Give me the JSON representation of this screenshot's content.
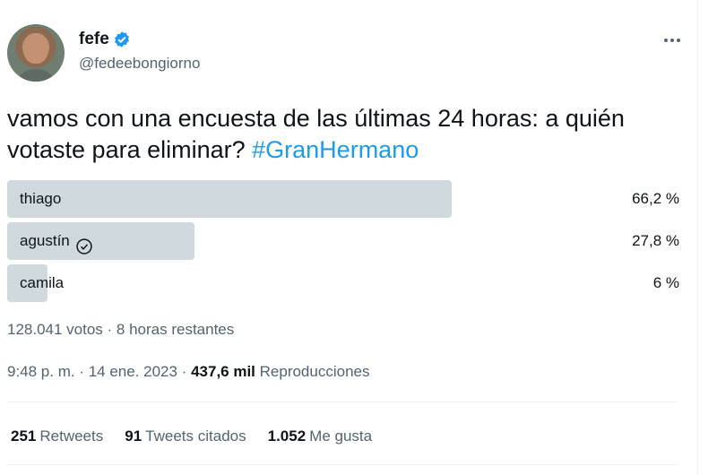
{
  "author": {
    "display_name": "fefe",
    "handle": "@fedeebongiorno"
  },
  "icons": {
    "verified": "verified-badge-icon",
    "more": "more-options-icon",
    "voted": "check-circle-icon"
  },
  "colors": {
    "accent": "#1d9bf0",
    "poll_bar": "#cfd9de",
    "secondary_text": "#536471"
  },
  "tweet": {
    "text": "vamos con una encuesta de las últimas 24 horas: a quién votaste para eliminar? ",
    "hashtag": "#GranHermano"
  },
  "poll": {
    "options": [
      {
        "label": "thiago",
        "percent_text": "66,2 %",
        "percent": 66.2,
        "voted": false
      },
      {
        "label": "agustín",
        "percent_text": "27,8 %",
        "percent": 27.8,
        "voted": true
      },
      {
        "label": "camila",
        "percent_text": "6 %",
        "percent": 6,
        "voted": false
      }
    ],
    "meta": "128.041 votos · 8 horas restantes"
  },
  "timestamp": {
    "time_date": "9:48 p. m. · 14 ene. 2023 · ",
    "views_count": "437,6 mil",
    "views_label": " Reproducciones"
  },
  "stats": {
    "retweets_count": "251",
    "retweets_label": "Retweets",
    "quotes_count": "91",
    "quotes_label": "Tweets citados",
    "likes_count": "1.052",
    "likes_label": "Me gusta"
  }
}
